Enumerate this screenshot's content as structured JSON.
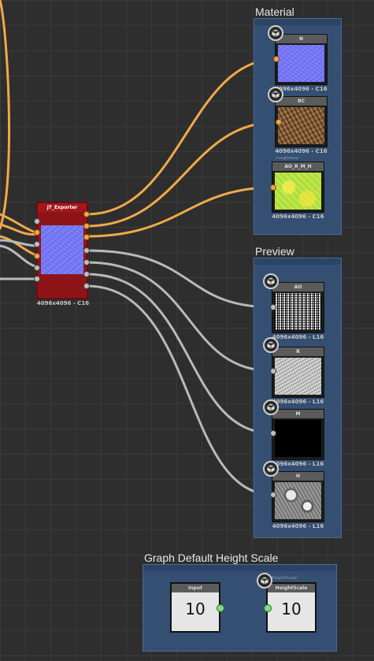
{
  "frames": {
    "material": "Material",
    "preview": "Preview",
    "height_scale": "Graph Default Height Scale"
  },
  "exporter": {
    "title": "JT_Exporter",
    "res": "4096x4096 - C16"
  },
  "material_nodes": [
    {
      "label": "N",
      "res": "4096x4096 - C16"
    },
    {
      "label": "BC",
      "res": "4096x4096 - C16",
      "sub": "/roughness/"
    },
    {
      "label": "AO_R_M_H",
      "res": "4096x4096 - C16"
    }
  ],
  "preview_nodes": [
    {
      "label": "AO",
      "res": "4096x4096 - L16"
    },
    {
      "label": "R",
      "res": "4096x4096 - L16"
    },
    {
      "label": "M",
      "res": "4096x4096 - L16"
    },
    {
      "label": "H",
      "res": "4096x4096 - L16"
    }
  ],
  "height_nodes": {
    "input_label": "Input",
    "input_value": "10",
    "output_label": "HeightScale",
    "output_value": "10",
    "output_sub": "/HeightScale/"
  },
  "icons": {
    "node_icon": "cube-icon"
  },
  "colors": {
    "wire_orange": "#f0a94a",
    "wire_gray": "#b9b9b9",
    "wire_green": "#7ee07a",
    "frame": "#344f72",
    "exporter": "#8f1418"
  }
}
